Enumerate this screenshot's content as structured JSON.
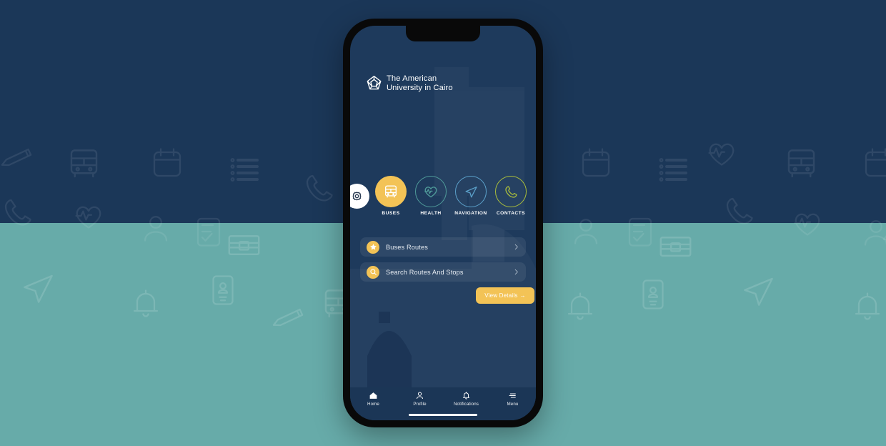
{
  "theme": {
    "navy": "#1b3758",
    "teal": "#67aba9",
    "screen_navy": "#1e3a5c",
    "accent_yellow": "#f3c356",
    "health_teal": "#4f9a99",
    "navigation_blue": "#5ba0c9",
    "contacts_green": "#a9bd3c",
    "nav_bar_navy": "#1b3656"
  },
  "phone": {
    "brand": {
      "logo_icon": "auc-pentagon-logo-icon",
      "name": "The American\nUniversity in Cairo"
    },
    "settings": {
      "icon": "gear-icon",
      "label": "Settings"
    },
    "categories": [
      {
        "id": "buses",
        "label": "BUSES",
        "icon": "bus-icon",
        "style": "filled",
        "color": "#f3c356",
        "active": true
      },
      {
        "id": "health",
        "label": "HEALTH",
        "icon": "heart-pulse-icon",
        "style": "outline",
        "color": "#4f9a99",
        "active": false
      },
      {
        "id": "navigation",
        "label": "NAVIGATION",
        "icon": "paper-plane-icon",
        "style": "outline",
        "color": "#5ba0c9",
        "active": false
      },
      {
        "id": "contacts",
        "label": "CONTACTS",
        "icon": "phone-icon",
        "style": "outline",
        "color": "#a9bd3c",
        "active": false
      }
    ],
    "list_rows": [
      {
        "id": "buses-routes",
        "label": "Buses Routes",
        "badge_icon": "star-icon",
        "chevron": "chevron-right-icon"
      },
      {
        "id": "search-routes-and-stops",
        "label": "Search Routes And Stops",
        "badge_icon": "search-icon",
        "chevron": "chevron-right-icon"
      }
    ],
    "view_details_button": {
      "label": "View Details",
      "arrow": "→"
    },
    "bottom_nav": [
      {
        "id": "home",
        "label": "Home",
        "icon": "home-icon",
        "active": true
      },
      {
        "id": "profile",
        "label": "Profile",
        "icon": "person-icon",
        "active": false
      },
      {
        "id": "notifications",
        "label": "Notifications",
        "icon": "bell-icon",
        "active": false
      },
      {
        "id": "menu",
        "label": "Menu",
        "icon": "hamburger-menu-icon",
        "active": false
      }
    ]
  },
  "background": {
    "pattern_icons": [
      "pencil-icon",
      "bus-icon",
      "calendar-icon",
      "list-icon",
      "phone-icon",
      "heart-pulse-icon",
      "person-icon",
      "clipboard-check-icon",
      "briefcase-icon",
      "paper-plane-icon",
      "bell-icon",
      "id-card-icon"
    ],
    "top_color": "#1b3758",
    "bottom_color": "#67aba9"
  }
}
